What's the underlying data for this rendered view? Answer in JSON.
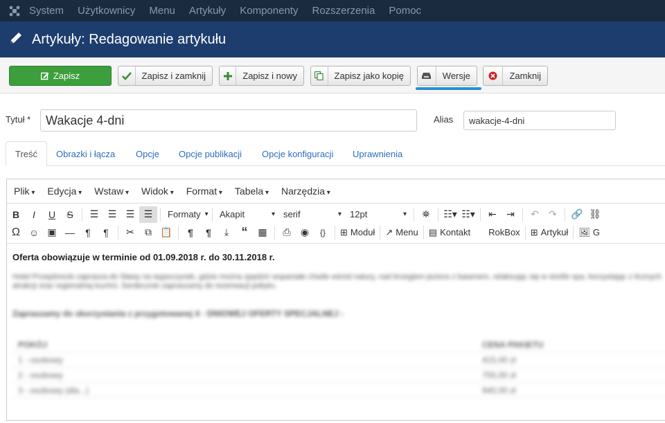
{
  "topnav": {
    "items": [
      "System",
      "Użytkownicy",
      "Menu",
      "Artykuły",
      "Komponenty",
      "Rozszerzenia",
      "Pomoc"
    ]
  },
  "titlebar": {
    "title": "Artykuły: Redagowanie artykułu"
  },
  "toolbar": {
    "save": "Zapisz",
    "save_close": "Zapisz i zamknij",
    "save_new": "Zapisz i nowy",
    "save_copy": "Zapisz jako kopię",
    "versions": "Wersje",
    "close": "Zamknij"
  },
  "form": {
    "title_label": "Tytuł *",
    "title_value": "Wakacje 4-dni",
    "alias_label": "Alias",
    "alias_value": "wakacje-4-dni"
  },
  "tabs": [
    "Treść",
    "Obrazki i łącza",
    "Opcje",
    "Opcje publikacji",
    "Opcje konfiguracji",
    "Uprawnienia"
  ],
  "editor": {
    "menu": [
      "Plik",
      "Edycja",
      "Wstaw",
      "Widok",
      "Format",
      "Tabela",
      "Narzędzia"
    ],
    "formats_label": "Formaty",
    "block_label": "Akapit",
    "font_label": "serif",
    "size_label": "12pt",
    "module_button": "Moduł",
    "menu_button": "Menu",
    "contact_button": "Kontakt",
    "rokbox_button": "RokBox",
    "article_button": "Artykuł",
    "image_button": "G",
    "first_line": "Oferta obowiązuje w terminie od 01.09.2018 r. do 30.11.2018 r.",
    "blurred_paragraph": "Hotel Przepiórecki zaprasza do Sławy na wypoczynek, gdzie można spędzić wspaniałe chwile wśród natury, nad brzegiem jeziora z basenem, relaksując się w strefie spa, korzystając z licznych atrakcji oraz regionalnej kuchni. Serdecznie zapraszamy do rezerwacji pobytu.",
    "blurred_heading": "Zapraszamy do skorzystania z przygotowanej 4 - DNIOWEJ OFERTY SPECJALNEJ :",
    "table_headers": [
      "POKÓJ",
      "CENA PAKIETU"
    ],
    "table_rows": [
      [
        "1 - osobowy",
        "415,00 zł"
      ],
      [
        "2 - osobowy",
        "755,00 zł"
      ],
      [
        "3 - osobowy (dla...)",
        "940,00 zł"
      ]
    ]
  }
}
